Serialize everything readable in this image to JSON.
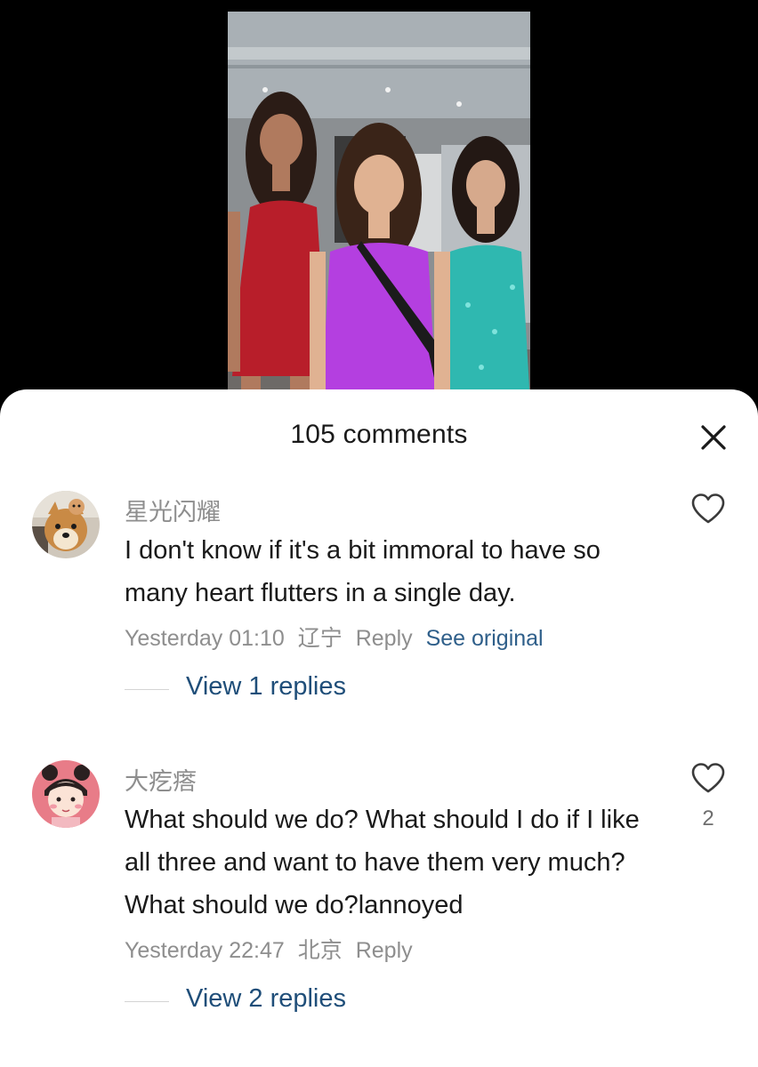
{
  "sheet": {
    "title": "105 comments",
    "close_icon": "close-icon"
  },
  "comments": [
    {
      "username": "星光闪耀",
      "text": "I don't know if it's a bit immoral to have so many heart flutters in a single day.",
      "time": "Yesterday 01:10",
      "location": "辽宁",
      "reply_label": "Reply",
      "see_original_label": "See original",
      "view_replies_label": "View 1 replies",
      "likes": "",
      "avatar_icon": "dog-avatar"
    },
    {
      "username": "大疙瘩",
      "text": "What should we do? What should I do if I like all three and want to have them very much? What should we do?lannoyed",
      "time": "Yesterday 22:47",
      "location": "北京",
      "reply_label": "Reply",
      "view_replies_label": "View 2 replies",
      "likes": "2",
      "avatar_icon": "cartoon-girl-avatar"
    }
  ],
  "colors": {
    "link": "#1f4e79",
    "muted": "#8e8e8e",
    "text": "#1a1a1a"
  }
}
